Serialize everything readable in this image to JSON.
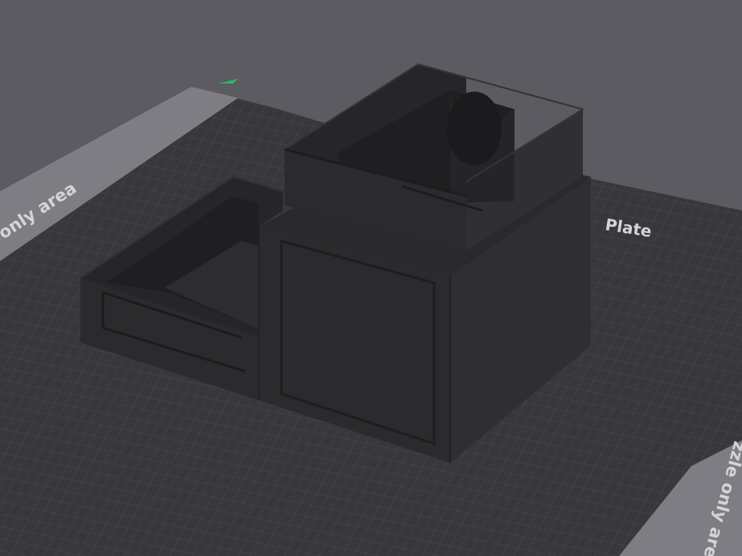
{
  "scene": {
    "plate_label": "Plate",
    "zone_label_left": "only area",
    "zone_label_right": "zzle only area"
  },
  "colors": {
    "background": "#5b5b61",
    "plate": "#37373c",
    "grid_line": "#4a4a50",
    "zone_strip": "#8a8a8f",
    "model_body": "#2b2b2d",
    "axis_marker": "#2fb86a"
  },
  "icons": {
    "axis_marker": "axis-arrow-icon"
  }
}
